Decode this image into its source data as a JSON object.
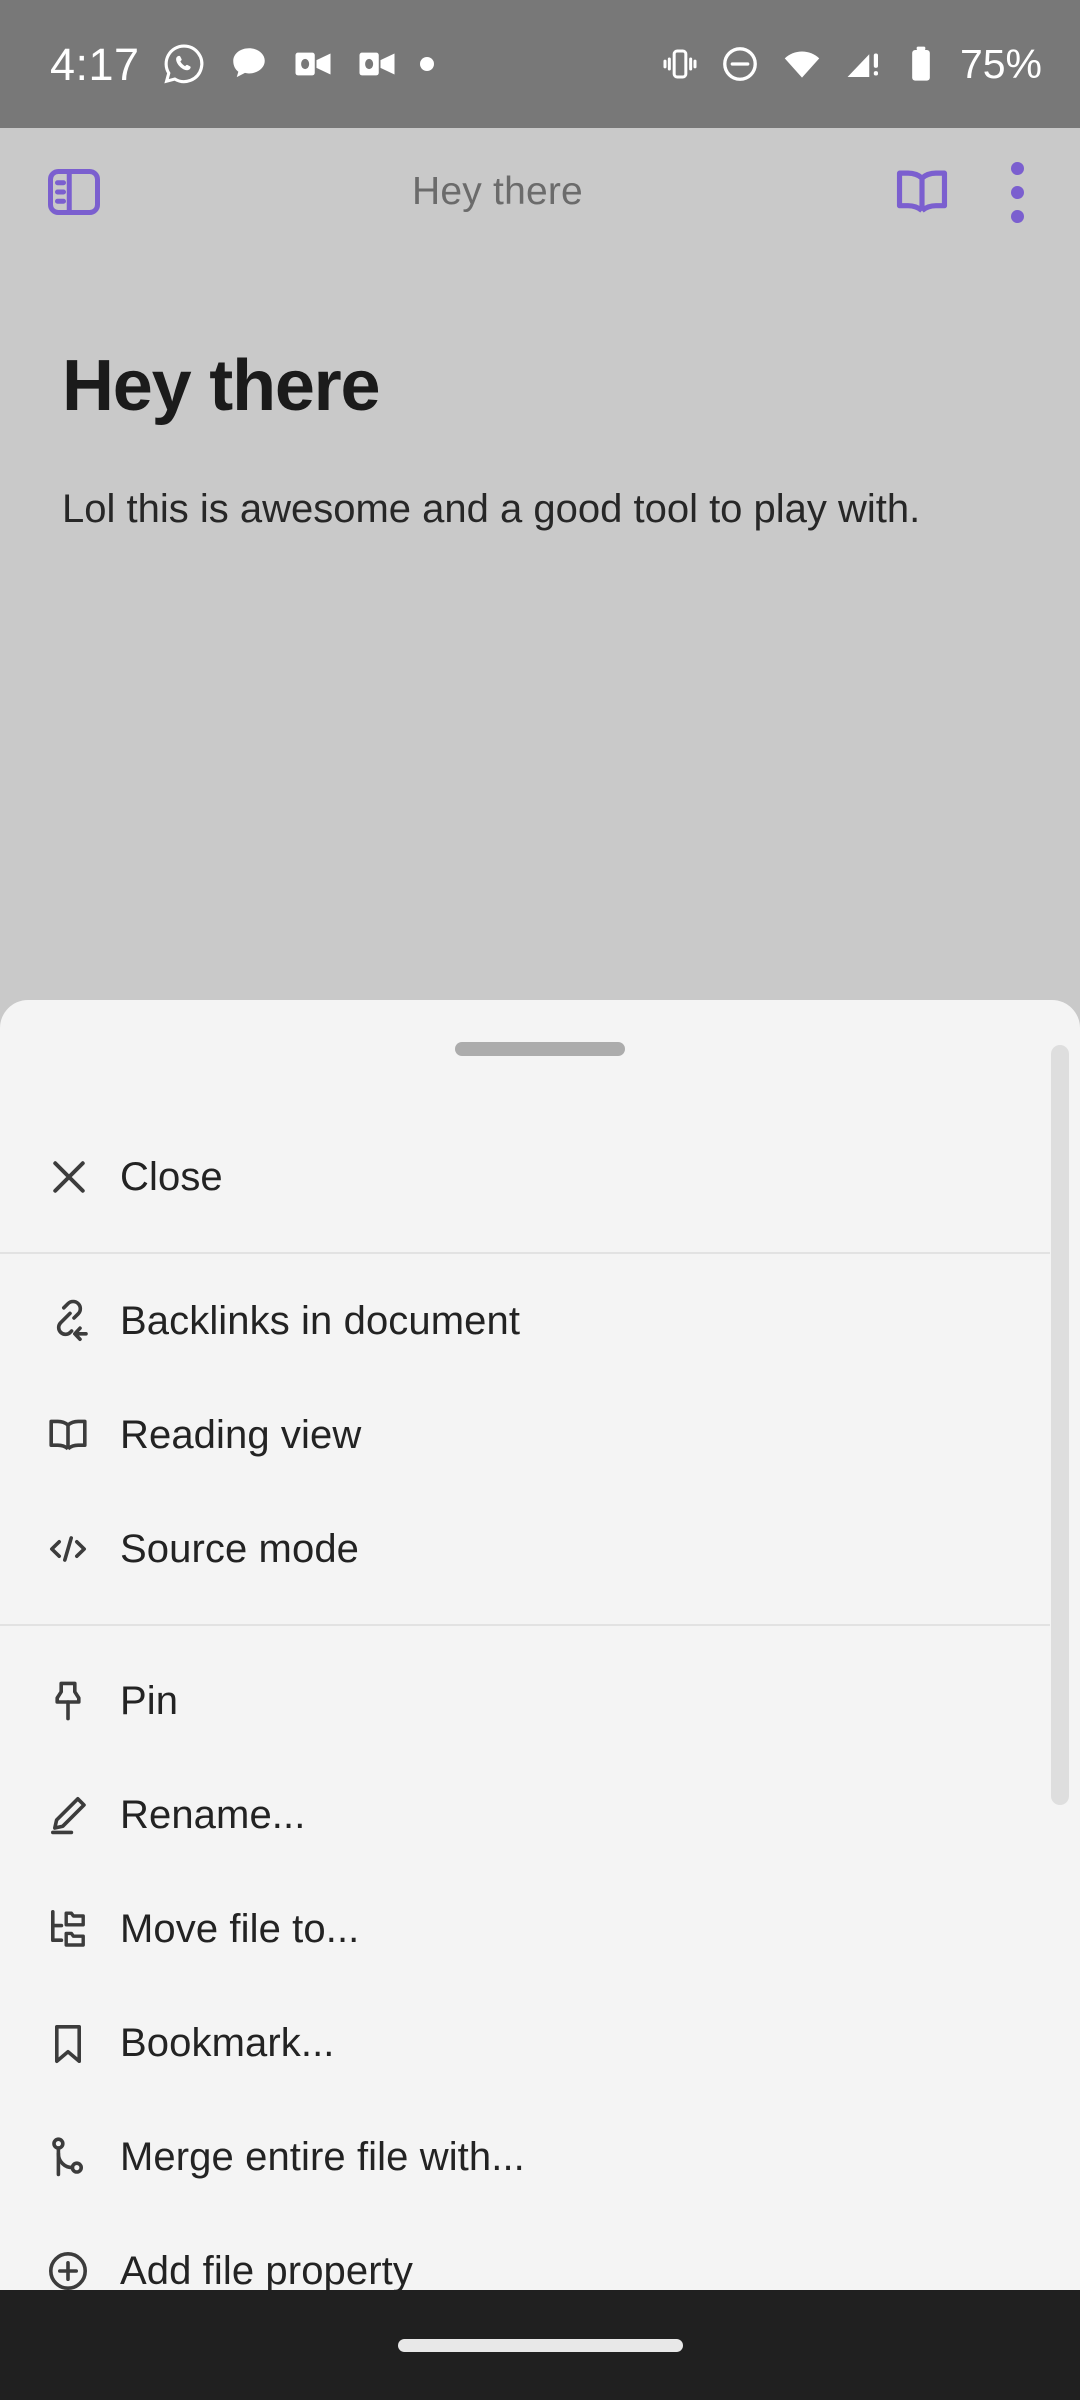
{
  "status_bar": {
    "time": "4:17",
    "battery_percent": "75%",
    "left_icons": [
      "whatsapp-icon",
      "messages-icon",
      "outlook-icon",
      "outlook-icon",
      "notification-dot-icon"
    ],
    "right_icons": [
      "vibrate-icon",
      "do-not-disturb-icon",
      "wifi-icon",
      "cellular-signal-warning-icon",
      "battery-icon"
    ],
    "background_color": "#787878"
  },
  "header": {
    "title": "Hey there",
    "left_icon": "sidebar-toggle-icon",
    "right_icons": [
      "reading-view-book-icon",
      "more-options-icon"
    ],
    "accent_color": "#7b5fcf"
  },
  "document": {
    "heading": "Hey there",
    "paragraph": "Lol this is awesome and a good tool to play with."
  },
  "sheet": {
    "background_color": "#f4f4f4",
    "groups": [
      {
        "items": [
          {
            "icon": "close-x-icon",
            "label": "Close"
          }
        ]
      },
      {
        "items": [
          {
            "icon": "backlinks-icon",
            "label": "Backlinks in document"
          },
          {
            "icon": "reading-view-book-icon",
            "label": "Reading view"
          },
          {
            "icon": "source-mode-code-icon",
            "label": "Source mode"
          }
        ]
      },
      {
        "items": [
          {
            "icon": "pin-icon",
            "label": "Pin"
          },
          {
            "icon": "rename-pencil-icon",
            "label": "Rename..."
          },
          {
            "icon": "move-file-icon",
            "label": "Move file to..."
          },
          {
            "icon": "bookmark-icon",
            "label": "Bookmark..."
          },
          {
            "icon": "merge-icon",
            "label": "Merge entire file with..."
          },
          {
            "icon": "add-file-property-icon",
            "label": "Add file property"
          }
        ]
      }
    ]
  },
  "nav_bar": {
    "home_indicator": "home-indicator",
    "background_color": "#202020"
  }
}
